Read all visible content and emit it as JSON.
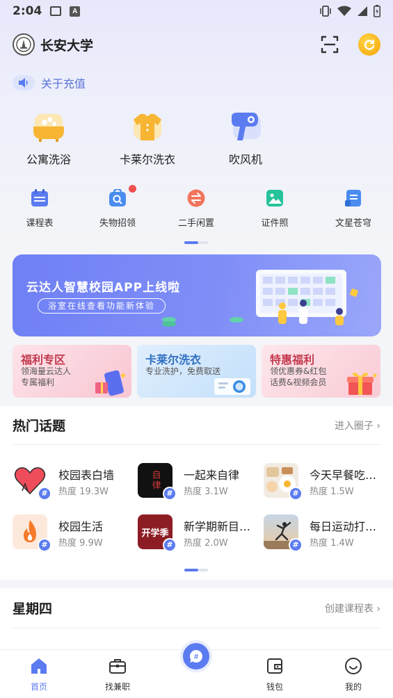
{
  "status_bar": {
    "time": "2:04",
    "icons": [
      "image-icon",
      "font-icon",
      "vibrate-icon",
      "wifi-icon",
      "signal-icon",
      "battery-icon"
    ]
  },
  "header": {
    "school_name": "长安大学",
    "icons": [
      "school-logo",
      "scan-icon",
      "coin-icon"
    ]
  },
  "notice": {
    "text": "关于充值",
    "icon": "speaker-icon"
  },
  "services": [
    {
      "label": "公寓洗浴",
      "icon": "bathtub-icon"
    },
    {
      "label": "卡莱尔洗衣",
      "icon": "shirt-icon"
    },
    {
      "label": "吹风机",
      "icon": "hair-dryer-icon"
    }
  ],
  "quick_links": [
    {
      "label": "课程表",
      "icon": "calendar-icon",
      "color": "#5b7bf0"
    },
    {
      "label": "失物招领",
      "icon": "lost-found-icon",
      "color": "#4a8cf0",
      "badge": true
    },
    {
      "label": "二手闲置",
      "icon": "exchange-icon",
      "color": "#f2745c"
    },
    {
      "label": "证件照",
      "icon": "photo-icon",
      "color": "#27c29b"
    },
    {
      "label": "文星苍穹",
      "icon": "document-icon",
      "color": "#4a8cf0"
    }
  ],
  "banner": {
    "title": "云达人智慧校园APP上线啦",
    "subtitle": "浴室在线查看功能新体验"
  },
  "promos": [
    {
      "title": "福利专区",
      "line1": "领海量云达人",
      "line2": "专属福利"
    },
    {
      "title": "卡莱尔洗衣",
      "line1": "专业洗护，免费取送",
      "line2": ""
    },
    {
      "title": "特惠福利",
      "line1": "领优惠券&红包",
      "line2": "话费&视频会员"
    }
  ],
  "topics": {
    "title": "热门话题",
    "more": "进入圈子 ›",
    "items": [
      {
        "name": "校园表白墙",
        "heat": "热度  19.3W",
        "icon": "heart-icon"
      },
      {
        "name": "一起来自律",
        "heat": "热度  3.1W",
        "icon": "self-discipline-icon"
      },
      {
        "name": "今天早餐吃…",
        "heat": "热度  1.5W",
        "icon": "breakfast-icon"
      },
      {
        "name": "校园生活",
        "heat": "热度  9.9W",
        "icon": "flame-icon"
      },
      {
        "name": "新学期新目…",
        "heat": "热度  2.0W",
        "icon": "new-semester-icon"
      },
      {
        "name": "每日运动打…",
        "heat": "热度  1.4W",
        "icon": "exercise-icon"
      }
    ],
    "tag_glyph": "#",
    "self_discipline_text": "自律",
    "semester_text": "开学季"
  },
  "day": {
    "title": "星期四",
    "action": "创建课程表 ›"
  },
  "tabbar": [
    {
      "label": "首页",
      "icon": "home-icon",
      "active": true
    },
    {
      "label": "找兼职",
      "icon": "briefcase-icon"
    },
    {
      "label": "",
      "icon": "topic-center-icon"
    },
    {
      "label": "钱包",
      "icon": "wallet-icon"
    },
    {
      "label": "我的",
      "icon": "smile-icon"
    }
  ]
}
